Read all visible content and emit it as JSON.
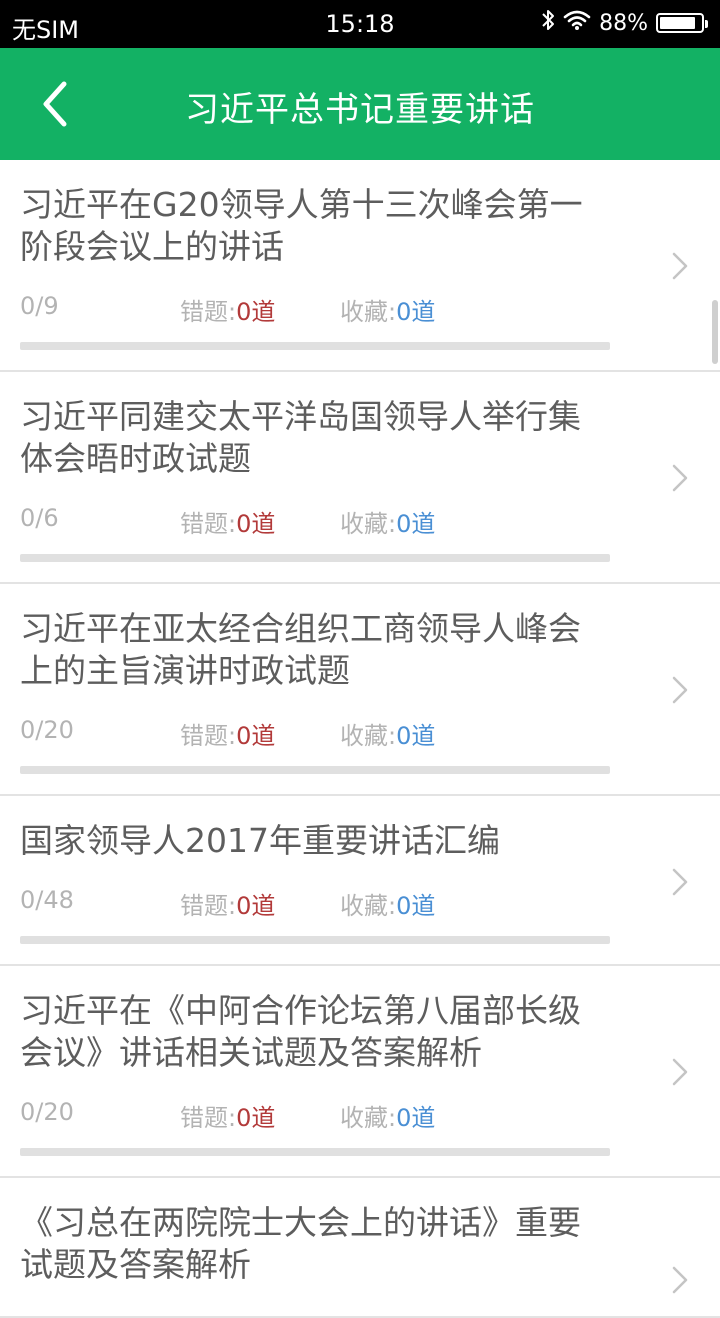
{
  "status_bar": {
    "carrier": "无SIM",
    "time": "15:18",
    "battery": "88%",
    "battery_level": 0.88,
    "icons": [
      "bluetooth-icon",
      "wifi-icon",
      "battery-icon"
    ]
  },
  "nav": {
    "title": "习近平总书记重要讲话",
    "back_icon": "chevron-left-icon"
  },
  "labels": {
    "wrong": "错题:",
    "fav": "收藏:"
  },
  "colors": {
    "accent": "#13b164",
    "wrong_value": "#b23a3a",
    "fav_value": "#4a8fd4"
  },
  "items": [
    {
      "title": "习近平在G20领导人第十三次峰会第一阶段会议上的讲话",
      "progress": "0/9",
      "progress_fraction": 0,
      "wrong": "0道",
      "fav": "0道"
    },
    {
      "title": "习近平同建交太平洋岛国领导人举行集体会晤时政试题",
      "progress": "0/6",
      "progress_fraction": 0,
      "wrong": "0道",
      "fav": "0道"
    },
    {
      "title": "习近平在亚太经合组织工商领导人峰会上的主旨演讲时政试题",
      "progress": "0/20",
      "progress_fraction": 0,
      "wrong": "0道",
      "fav": "0道"
    },
    {
      "title": "国家领导人2017年重要讲话汇编",
      "progress": "0/48",
      "progress_fraction": 0,
      "wrong": "0道",
      "fav": "0道"
    },
    {
      "title": "习近平在《中阿合作论坛第八届部长级会议》讲话相关试题及答案解析",
      "progress": "0/20",
      "progress_fraction": 0,
      "wrong": "0道",
      "fav": "0道"
    },
    {
      "title": "《习总在两院院士大会上的讲话》重要试题及答案解析",
      "progress": "",
      "progress_fraction": 0,
      "wrong": "",
      "fav": ""
    }
  ]
}
